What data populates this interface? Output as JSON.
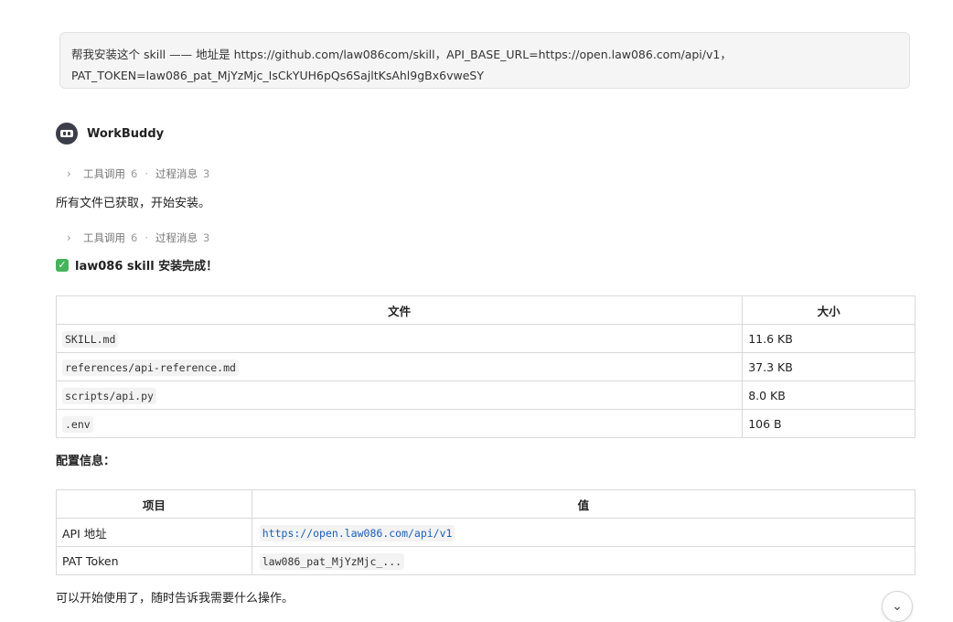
{
  "user_message": {
    "line1": "帮我安装这个 skill —— 地址是 https://github.com/law086com/skill，API_BASE_URL=https://open.law086.com/api/v1，",
    "line2": "PAT_TOKEN=law086_pat_MjYzMjc_IsCkYUH6pQs6SajltKsAhl9gBx6vweSY"
  },
  "assistant": {
    "name": "WorkBuddy",
    "avatar_icon": "raccoon-icon"
  },
  "tool_summaries": [
    {
      "tools_label": "工具调用",
      "tools_count": "6",
      "sep": "·",
      "process_label": "过程消息",
      "process_count": "3"
    },
    {
      "tools_label": "工具调用",
      "tools_count": "6",
      "sep": "·",
      "process_label": "过程消息",
      "process_count": "3"
    }
  ],
  "messages": {
    "fetched": "所有文件已获取，开始安装。",
    "done": "law086 skill 安装完成！",
    "config_title": "配置信息：",
    "closing": "可以开始使用了，随时告诉我需要什么操作。"
  },
  "files_table": {
    "headers": [
      "文件",
      "大小"
    ],
    "rows": [
      {
        "file": "SKILL.md",
        "size": "11.6 KB"
      },
      {
        "file": "references/api-reference.md",
        "size": "37.3 KB"
      },
      {
        "file": "scripts/api.py",
        "size": "8.0 KB"
      },
      {
        "file": ".env",
        "size": "106 B"
      }
    ]
  },
  "config_table": {
    "headers": [
      "项目",
      "值"
    ],
    "rows": [
      {
        "item": "API 地址",
        "value": "https://open.law086.com/api/v1"
      },
      {
        "item": "PAT Token",
        "value": "law086_pat_MjYzMjc_..."
      }
    ]
  },
  "colors": {
    "success": "#45b35b",
    "link": "#1a5fb4",
    "bubble_bg": "#f5f5f5"
  }
}
